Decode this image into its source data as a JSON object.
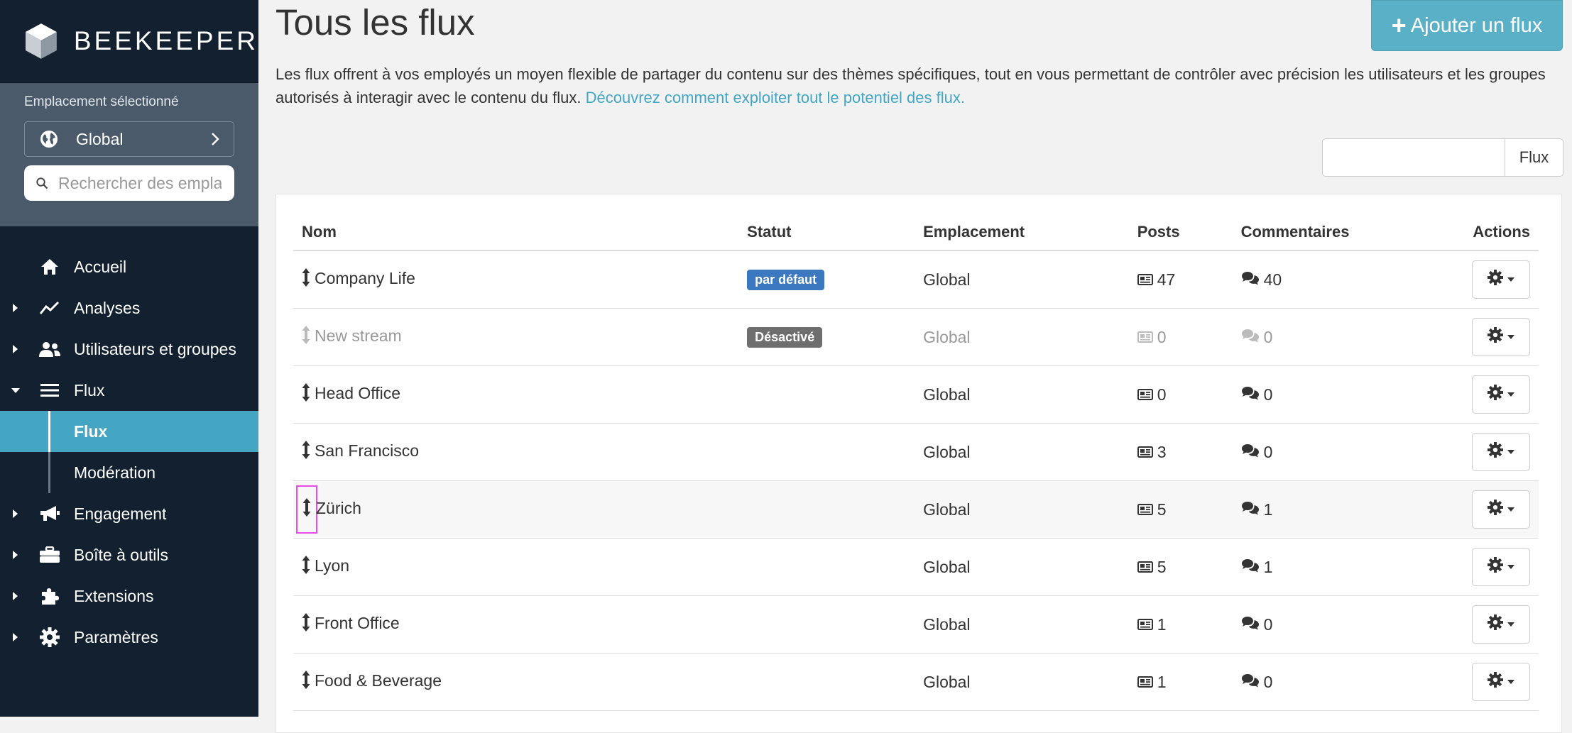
{
  "brand": {
    "name": "BEEKEEPER"
  },
  "location": {
    "label": "Emplacement sélectionné",
    "selected": "Global",
    "search_placeholder": "Rechercher des emplacements"
  },
  "nav": {
    "home": "Accueil",
    "analytics": "Analyses",
    "users": "Utilisateurs et groupes",
    "flux": "Flux",
    "flux_sub": "Flux",
    "moderation": "Modération",
    "engagement": "Engagement",
    "toolbox": "Boîte à outils",
    "extensions": "Extensions",
    "settings": "Paramètres"
  },
  "header": {
    "title": "Tous les flux",
    "add_button": "Ajouter un flux",
    "intro_text": "Les flux offrent à vos employés un moyen flexible de partager du contenu sur des thèmes spécifiques, tout en vous permettant de contrôler avec précision les utilisateurs et les groupes autorisés à interagir avec le contenu du flux.",
    "intro_link": "Découvrez comment exploiter tout le potentiel des flux."
  },
  "search": {
    "value": "",
    "button": "Flux"
  },
  "table": {
    "headers": {
      "name": "Nom",
      "status": "Statut",
      "location": "Emplacement",
      "posts": "Posts",
      "comments": "Commentaires",
      "actions": "Actions"
    },
    "rows": [
      {
        "name": "Company Life",
        "status": "par défaut",
        "location": "Global",
        "posts": "47",
        "comments": "40"
      },
      {
        "name": "New stream",
        "status": "Désactivé",
        "location": "Global",
        "posts": "0",
        "comments": "0"
      },
      {
        "name": "Head Office",
        "status": "",
        "location": "Global",
        "posts": "0",
        "comments": "0"
      },
      {
        "name": "San Francisco",
        "status": "",
        "location": "Global",
        "posts": "3",
        "comments": "0"
      },
      {
        "name": "Zürich",
        "status": "",
        "location": "Global",
        "posts": "5",
        "comments": "1"
      },
      {
        "name": "Lyon",
        "status": "",
        "location": "Global",
        "posts": "5",
        "comments": "1"
      },
      {
        "name": "Front Office",
        "status": "",
        "location": "Global",
        "posts": "1",
        "comments": "0"
      },
      {
        "name": "Food & Beverage",
        "status": "",
        "location": "Global",
        "posts": "1",
        "comments": "0"
      }
    ]
  },
  "colors": {
    "sidebar": "#13202f",
    "accent": "#45a6c4",
    "badge_default": "#3c78c0",
    "badge_disabled": "#6e6e6e"
  }
}
